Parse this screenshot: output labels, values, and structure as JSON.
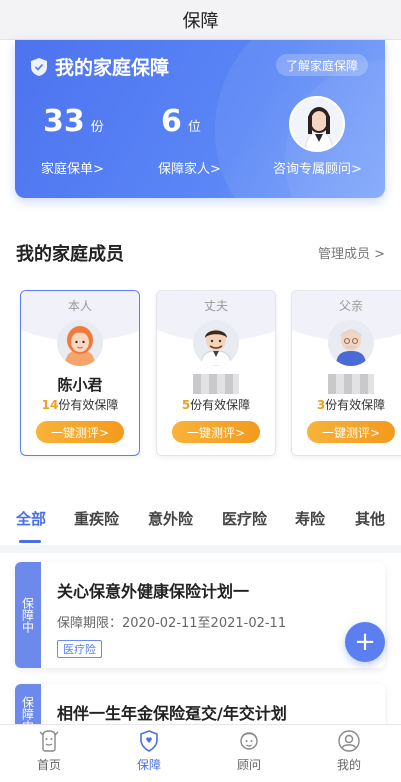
{
  "topbar": {
    "title": "保障"
  },
  "hero": {
    "title": "我的家庭保障",
    "learn_button": "了解家庭保障",
    "policies_count": "33",
    "policies_unit": "份",
    "policies_link": "家庭保单>",
    "insured_count": "6",
    "insured_unit": "位",
    "insured_link": "保障家人>",
    "advisor_link": "咨询专属顾问>"
  },
  "members_section": {
    "title": "我的家庭成员",
    "manage_link": "管理成员 >"
  },
  "members": [
    {
      "role": "本人",
      "name": "陈小君",
      "count": "14",
      "policies_suffix": "份有效保障",
      "button": "一键测评>"
    },
    {
      "role": "丈夫",
      "name": "",
      "count": "5",
      "policies_suffix": "份有效保障",
      "button": "一键测评>"
    },
    {
      "role": "父亲",
      "name": "",
      "count": "3",
      "policies_suffix": "份有效保障",
      "button": "一键测评>"
    }
  ],
  "tabs": [
    "全部",
    "重疾险",
    "意外险",
    "医疗险",
    "寿险",
    "其他"
  ],
  "policies": [
    {
      "status": "保障中",
      "title": "关心保意外健康保险计划一",
      "period": "保障期限：2020-02-11至2021-02-11",
      "tag": "医疗险"
    },
    {
      "status": "保障中",
      "title": "相伴一生年金保险趸交/年交计划"
    }
  ],
  "fab": {
    "label": "+"
  },
  "bottom_nav": [
    {
      "label": "首页",
      "icon": "home-icon"
    },
    {
      "label": "保障",
      "icon": "shield-icon"
    },
    {
      "label": "顾问",
      "icon": "advisor-icon"
    },
    {
      "label": "我的",
      "icon": "profile-icon"
    }
  ],
  "colors": {
    "accent": "#4b6fe6",
    "orange": "#f39a1e"
  }
}
